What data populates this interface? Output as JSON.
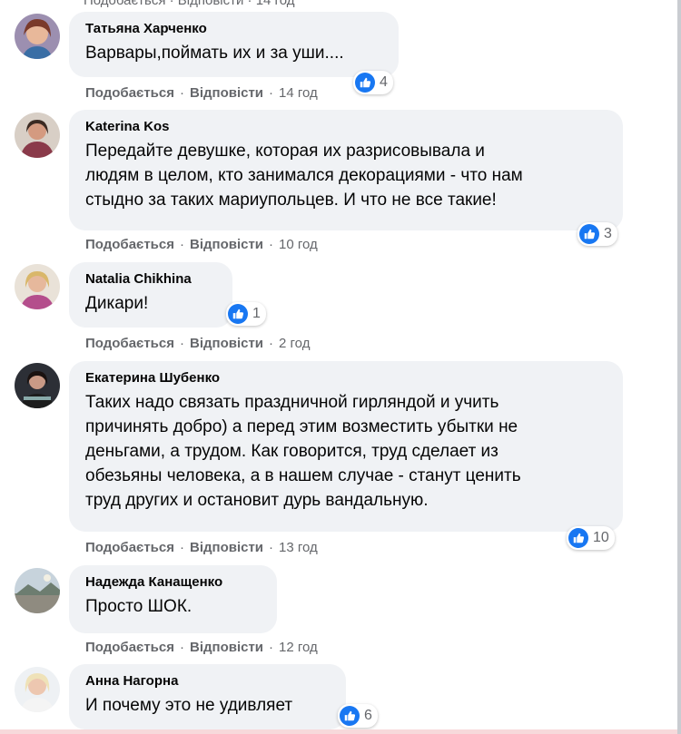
{
  "top_cut_text": "Подобається · Відповісти · 14 год",
  "comments": [
    {
      "author": "Татьяна Харченко",
      "lines": [
        "Варвары,поймать их и за уши...."
      ],
      "likes": "4",
      "like_label": "Подобається",
      "reply_label": "Відповісти",
      "time": "14 год"
    },
    {
      "author": "Katerina Kos",
      "lines": [
        "Передайте девушке, которая их разрисовывала и",
        "людям в целом, кто занимался декорациями - что нам",
        "стыдно за таких мариупольцев. И что не все такие!"
      ],
      "likes": "3",
      "like_label": "Подобається",
      "reply_label": "Відповісти",
      "time": "10 год"
    },
    {
      "author": "Natalia Chikhina",
      "lines": [
        "Дикари!"
      ],
      "likes": "1",
      "like_label": "Подобається",
      "reply_label": "Відповісти",
      "time": "2 год"
    },
    {
      "author": "Екатерина Шубенко",
      "lines": [
        "Таких надо связать праздничной гирляндой и учить",
        "причинять добро) а перед этим возместить убытки не",
        "деньгами, а трудом. Как говорится, труд сделает из",
        "обезьяны человека, а в нашем случае - станут ценить",
        "труд других и остановит дурь вандальную."
      ],
      "likes": "10",
      "like_label": "Подобається",
      "reply_label": "Відповісти",
      "time": "13 год"
    },
    {
      "author": "Надежда Канащенко",
      "lines": [
        "Просто ШОК."
      ],
      "likes": "",
      "like_label": "Подобається",
      "reply_label": "Відповісти",
      "time": "12 год"
    },
    {
      "author": "Анна Нагорна",
      "lines": [
        "И почему это не удивляет"
      ],
      "likes": "6",
      "like_label": "",
      "reply_label": "",
      "time": ""
    }
  ],
  "colors": {
    "bubble": "#f0f2f5",
    "like_blue": "#1877f2",
    "meta": "#65676b"
  },
  "icons": {
    "reaction": "thumbs-up-icon"
  }
}
